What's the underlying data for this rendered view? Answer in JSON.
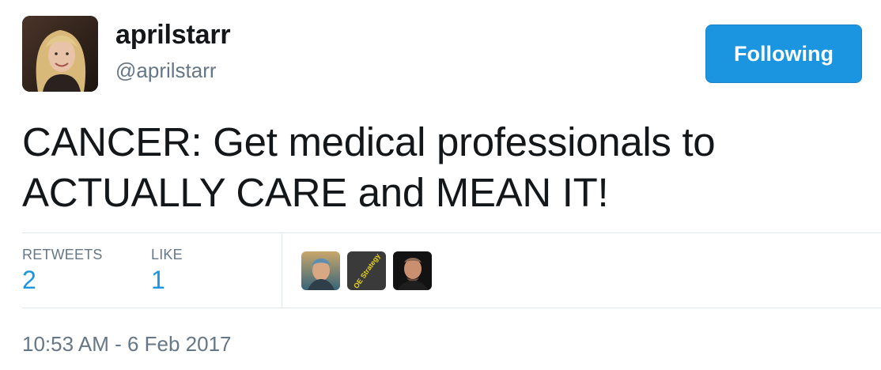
{
  "user": {
    "display_name": "aprilstarr",
    "handle": "@aprilstarr",
    "avatar_icon": "profile-photo"
  },
  "follow_button": {
    "label": "Following",
    "color": "#1b95e0"
  },
  "tweet": {
    "line1": "CANCER: Get medical professionals to",
    "line2": "ACTUALLY CARE and MEAN IT!"
  },
  "stats": {
    "retweets_label": "RETWEETS",
    "retweets_count": "2",
    "likes_label": "LIKE",
    "likes_count": "1",
    "accent_color": "#1b95e0"
  },
  "likers": [
    {
      "icon": "user-avatar-1"
    },
    {
      "icon": "oe-strategy-avatar",
      "text": "OE Strategy"
    },
    {
      "icon": "user-avatar-3"
    }
  ],
  "timestamp": "10:53 AM - 6 Feb 2017"
}
